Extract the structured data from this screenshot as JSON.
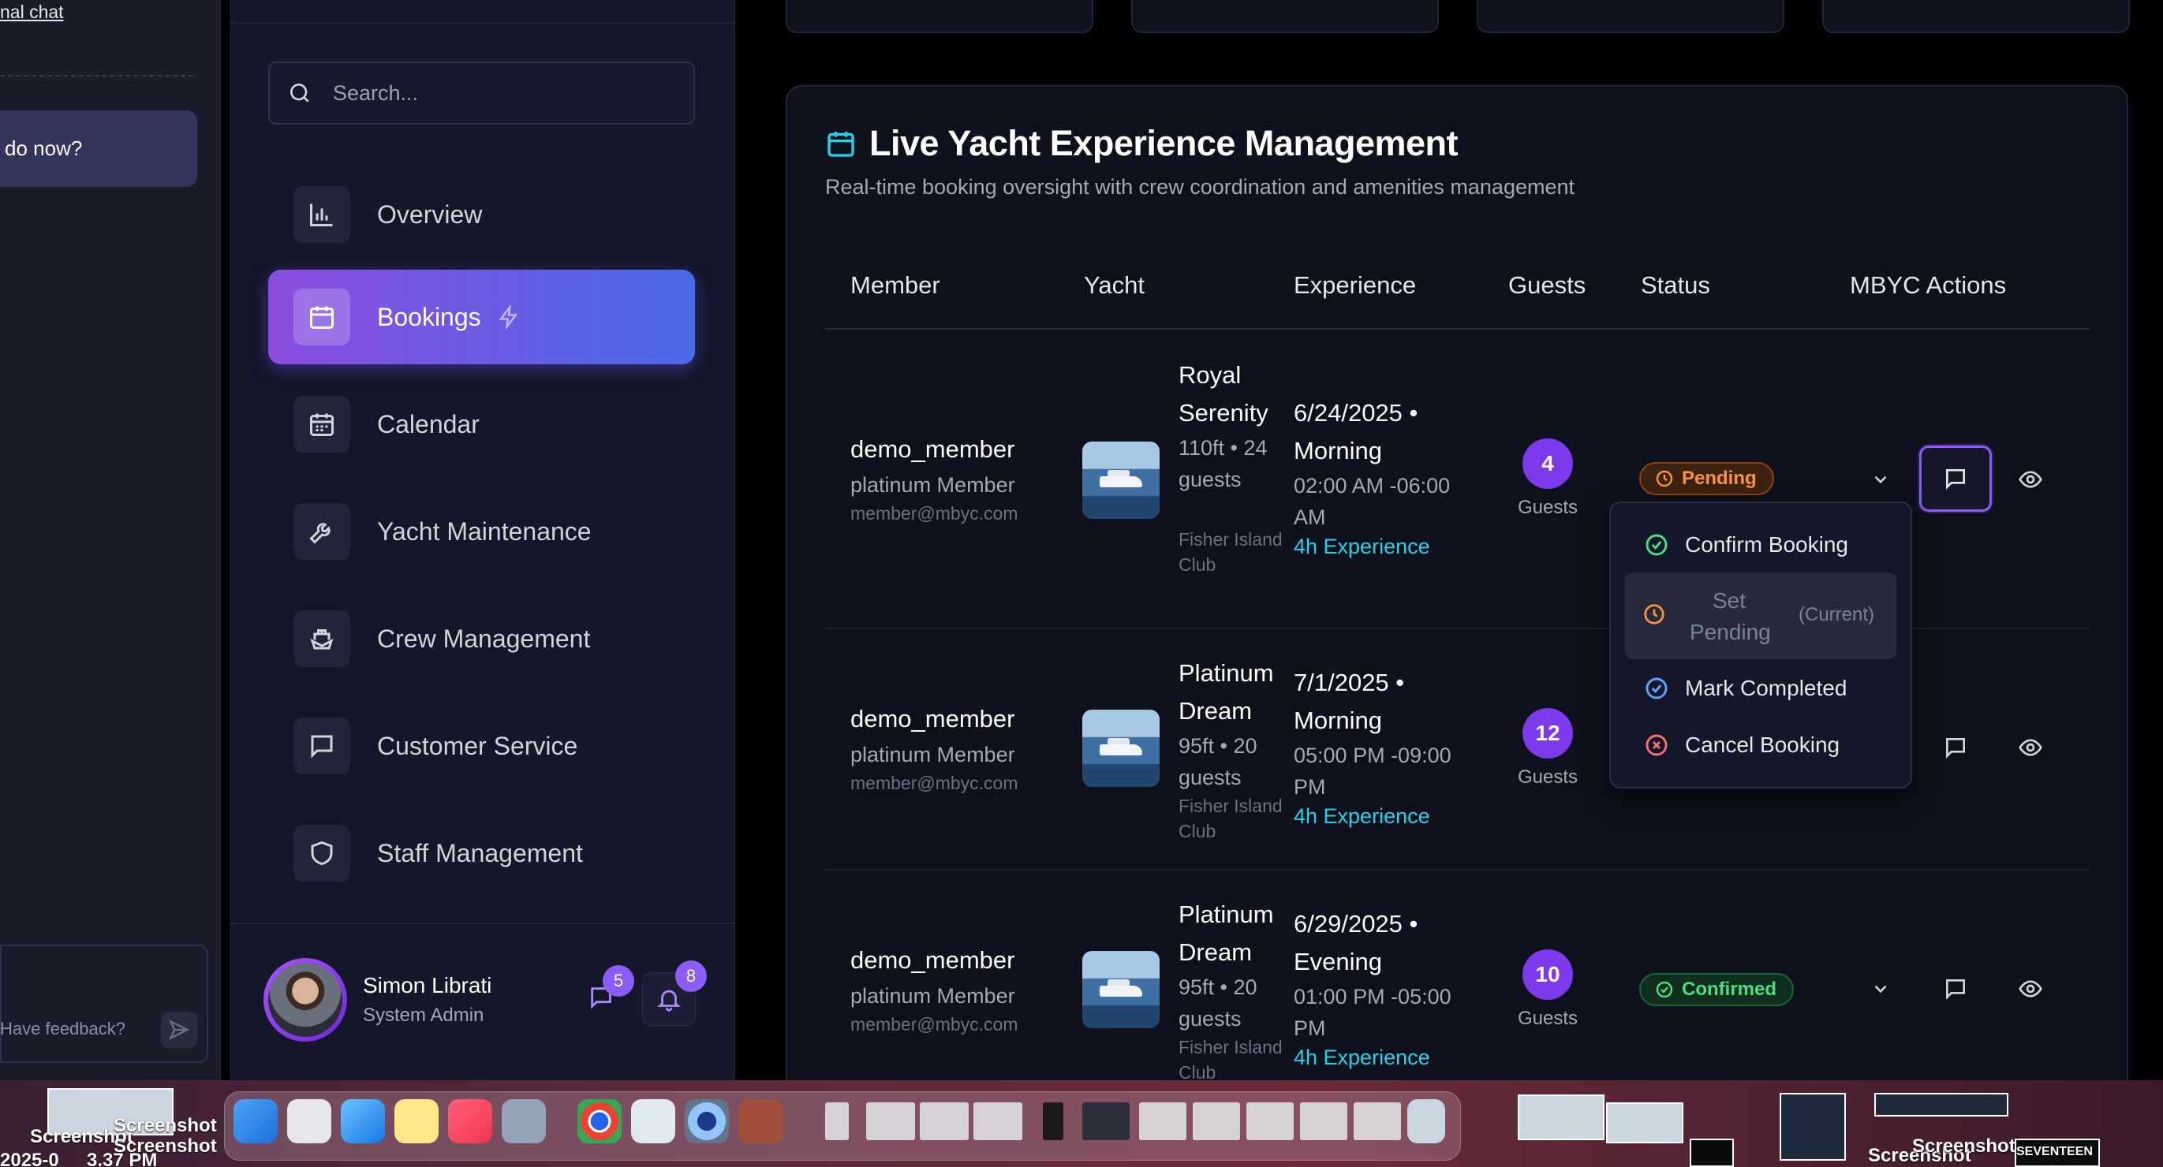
{
  "chat": {
    "link_text": "nal chat",
    "bubble_text": "do now?",
    "feedback_placeholder": "Have feedback?"
  },
  "sidebar": {
    "search_placeholder": "Search...",
    "items": [
      {
        "label": "Overview",
        "icon": "bar-chart-icon",
        "active": false
      },
      {
        "label": "Bookings",
        "icon": "calendar-icon",
        "active": true
      },
      {
        "label": "Calendar",
        "icon": "calendar-grid-icon",
        "active": false
      },
      {
        "label": "Yacht Maintenance",
        "icon": "wrench-icon",
        "active": false
      },
      {
        "label": "Crew Management",
        "icon": "ship-icon",
        "active": false
      },
      {
        "label": "Customer Service",
        "icon": "message-square-icon",
        "active": false
      },
      {
        "label": "Staff Management",
        "icon": "shield-icon",
        "active": false
      }
    ],
    "user": {
      "name": "Simon Librati",
      "role": "System Admin"
    },
    "message_count": "5",
    "notification_count": "8"
  },
  "main": {
    "title": "Live Yacht Experience Management",
    "subtitle": "Real-time booking oversight with crew coordination and amenities management",
    "columns": [
      "Member",
      "Yacht",
      "Experience",
      "Guests",
      "Status",
      "MBYC Actions"
    ],
    "rows": [
      {
        "member": "demo_member",
        "tier": "platinum Member",
        "email": "member@mbyc.com",
        "yacht_name": "Royal Serenity",
        "yacht_spec": "110ft • 24 guests",
        "yacht_club": "Fisher Island Club",
        "date": "6/24/2025 • Morning",
        "time": "02:00 AM -06:00 AM",
        "duration": "4h Experience",
        "guests": "4",
        "guests_label": "Guests",
        "status": "Pending"
      },
      {
        "member": "demo_member",
        "tier": "platinum Member",
        "email": "member@mbyc.com",
        "yacht_name": "Platinum Dream",
        "yacht_spec": "95ft • 20 guests",
        "yacht_club": "Fisher Island Club",
        "date": "7/1/2025 • Morning",
        "time": "05:00 PM -09:00 PM",
        "duration": "4h Experience",
        "guests": "12",
        "guests_label": "Guests",
        "status": ""
      },
      {
        "member": "demo_member",
        "tier": "platinum Member",
        "email": "member@mbyc.com",
        "yacht_name": "Platinum Dream",
        "yacht_spec": "95ft • 20 guests",
        "yacht_club": "Fisher Island Club",
        "date": "6/29/2025 • Evening",
        "time": "01:00 PM -05:00 PM",
        "duration": "4h Experience",
        "guests": "10",
        "guests_label": "Guests",
        "status": "Confirmed"
      }
    ],
    "status_menu": {
      "confirm": "Confirm Booking",
      "pending": "Set Pending",
      "pending_note": "(Current)",
      "complete": "Mark Completed",
      "cancel": "Cancel Booking"
    }
  },
  "desktop": {
    "labels": [
      "Screenshot",
      "Screenshot",
      "2025-0",
      "Screenshot",
      "3.37 PM",
      "Screenshot",
      "Screenshot",
      "Screenshot",
      "SEVENTEEN"
    ]
  },
  "colors": {
    "accent_purple": "#8b5cf6",
    "accent_blue": "#4a6ae8",
    "pending": "#fb923c",
    "confirmed": "#4ade80",
    "duration": "#22d3ee"
  }
}
